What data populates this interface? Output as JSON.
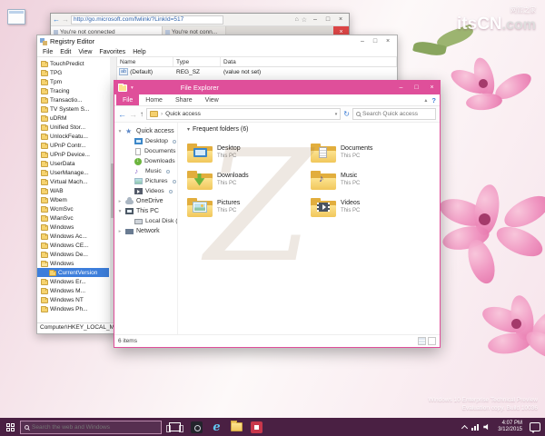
{
  "colors": {
    "accent": "#df4f9a",
    "taskbar_bg": "#4a2043",
    "selection": "#3d7edb"
  },
  "site_watermark": {
    "cn_small": "网管之家",
    "brand": "itsCN",
    "suffix": ".com",
    "center_glyph": "Z"
  },
  "build_watermark": {
    "line1": "Windows 10 Enterprise Technical Preview",
    "line2": "Evaluation copy. Build 10036"
  },
  "browser": {
    "url": "http://go.microsoft.com/fwlink/?LinkId=517",
    "tabs": [
      {
        "label": "You're not connected",
        "active": true
      },
      {
        "label": "You're not conn...",
        "active": false
      }
    ]
  },
  "regedit": {
    "title": "Registry Editor",
    "menu": [
      "File",
      "Edit",
      "View",
      "Favorites",
      "Help"
    ],
    "columns": [
      "Name",
      "Type",
      "Data"
    ],
    "values": [
      {
        "name": "(Default)",
        "type": "REG_SZ",
        "data": "(value not set)"
      }
    ],
    "tree": [
      {
        "label": "TouchPredict",
        "indent": 0
      },
      {
        "label": "TPG",
        "indent": 0
      },
      {
        "label": "Tpm",
        "indent": 0
      },
      {
        "label": "Tracing",
        "indent": 0
      },
      {
        "label": "Transactio...",
        "indent": 0
      },
      {
        "label": "TV System S...",
        "indent": 0
      },
      {
        "label": "uDRM",
        "indent": 0
      },
      {
        "label": "Unified Stor...",
        "indent": 0
      },
      {
        "label": "UnlockFeatu...",
        "indent": 0
      },
      {
        "label": "UPnP Contr...",
        "indent": 0
      },
      {
        "label": "UPnP Device...",
        "indent": 0
      },
      {
        "label": "UserData",
        "indent": 0
      },
      {
        "label": "UserManage...",
        "indent": 0
      },
      {
        "label": "Virtual Mach...",
        "indent": 0
      },
      {
        "label": "WAB",
        "indent": 0
      },
      {
        "label": "Wbem",
        "indent": 0
      },
      {
        "label": "WcmSvc",
        "indent": 0
      },
      {
        "label": "WlanSvc",
        "indent": 0
      },
      {
        "label": "Windows",
        "indent": 0
      },
      {
        "label": "Windows Ac...",
        "indent": 0
      },
      {
        "label": "Windows CE...",
        "indent": 0
      },
      {
        "label": "Windows De...",
        "indent": 0
      },
      {
        "label": "Windows",
        "indent": 0,
        "open": true
      },
      {
        "label": "CurrentVersion",
        "indent": 1,
        "selected": true
      },
      {
        "label": "Windows Er...",
        "indent": 0
      },
      {
        "label": "Windows M...",
        "indent": 0
      },
      {
        "label": "Windows NT",
        "indent": 0
      },
      {
        "label": "Windows Ph...",
        "indent": 0
      }
    ],
    "status": "Computer\\HKEY_LOCAL_MACH..."
  },
  "explorer": {
    "title": "File Explorer",
    "ribbon_tabs": [
      {
        "label": "File",
        "accent": true
      },
      {
        "label": "Home"
      },
      {
        "label": "Share"
      },
      {
        "label": "View"
      }
    ],
    "breadcrumb": "Quick access",
    "search_placeholder": "Search Quick access",
    "nav": [
      {
        "label": "Quick access",
        "icon": "star",
        "root": true,
        "exp": "open"
      },
      {
        "label": "Desktop",
        "icon": "desktop",
        "pin": true
      },
      {
        "label": "Documents",
        "icon": "documents",
        "pin": true
      },
      {
        "label": "Downloads",
        "icon": "downloads",
        "pin": true
      },
      {
        "label": "Music",
        "icon": "music",
        "pin": true
      },
      {
        "label": "Pictures",
        "icon": "pictures",
        "pin": true
      },
      {
        "label": "Videos",
        "icon": "videos",
        "pin": true
      },
      {
        "label": "OneDrive",
        "icon": "onedrive",
        "root": true,
        "exp": "closed"
      },
      {
        "label": "This PC",
        "icon": "thispc",
        "root": true,
        "exp": "open"
      },
      {
        "label": "Local Disk (C:)",
        "icon": "disk"
      },
      {
        "label": "Network",
        "icon": "network",
        "root": true,
        "exp": "closed"
      }
    ],
    "group_header": "Frequent folders (6)",
    "tiles": [
      {
        "name": "Desktop",
        "location": "This PC",
        "icon": "desktop"
      },
      {
        "name": "Documents",
        "location": "This PC",
        "icon": "documents"
      },
      {
        "name": "Downloads",
        "location": "This PC",
        "icon": "downloads"
      },
      {
        "name": "Music",
        "location": "This PC",
        "icon": "music"
      },
      {
        "name": "Pictures",
        "location": "This PC",
        "icon": "pictures"
      },
      {
        "name": "Videos",
        "location": "This PC",
        "icon": "videos"
      }
    ],
    "status": "6 items"
  },
  "taskbar": {
    "search_placeholder": "Search the web and Windows",
    "time": "4:07 PM",
    "date": "3/12/2015"
  }
}
